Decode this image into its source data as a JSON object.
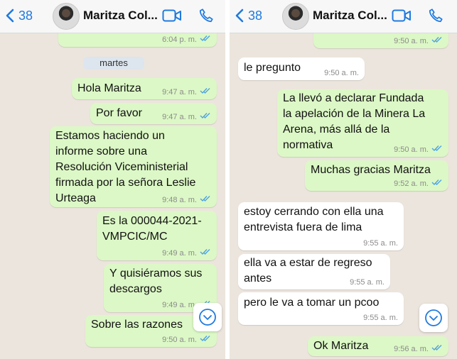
{
  "header": {
    "back_count": "38",
    "contact_name": "Maritza Col..."
  },
  "left_pane": {
    "messages": [
      {
        "text": "",
        "time": "6:04 p. m.",
        "type": "out"
      },
      {
        "text": "Hola Maritza",
        "time": "9:47 a. m.",
        "type": "out"
      },
      {
        "text": "Por favor",
        "time": "9:47 a. m.",
        "type": "out"
      },
      {
        "text": "Estamos haciendo un\ninforme sobre una\nResolución Viceministerial\nfirmada por la señora Leslie\nUrteaga",
        "time": "9:48 a. m.",
        "type": "out"
      },
      {
        "text": "Es la 000044-2021-\nVMPCIC/MC",
        "time": "9:49 a. m.",
        "type": "out"
      },
      {
        "text": "Y quisiéramos sus\ndescargos",
        "time": "9:49 a. m.",
        "type": "out"
      },
      {
        "text": "Sobre las razones",
        "time": "9:50 a. m.",
        "type": "out"
      }
    ],
    "day_separator": "martes"
  },
  "right_pane": {
    "messages": [
      {
        "text": "",
        "time": "9:50 a. m.",
        "type": "out"
      },
      {
        "text": "le pregunto",
        "time": "9:50 a. m.",
        "type": "in"
      },
      {
        "text": "La llevó a declarar Fundada\nla apelación de la Minera La\nArena, más allá de la\nnormativa",
        "time": "9:50 a. m.",
        "type": "out"
      },
      {
        "text": "Muchas gracias Maritza",
        "time": "9:52 a. m.",
        "type": "out"
      },
      {
        "text": "estoy cerrando con ella una\nentrevista fuera de lima",
        "time": "9:55 a. m.",
        "type": "in"
      },
      {
        "text": "ella va a estar de regreso\nantes",
        "time": "9:55 a. m.",
        "type": "in"
      },
      {
        "text": "pero le va a tomar un pcoo",
        "time": "9:55 a. m.",
        "type": "in"
      },
      {
        "text": "Ok Maritza",
        "time": "9:56 a. m.",
        "type": "out"
      }
    ]
  },
  "colors": {
    "outgoing_bubble": "#dcf8c6",
    "incoming_bubble": "#ffffff",
    "accent": "#1f7ae0",
    "read_ticks": "#4fa3e0"
  },
  "icons": [
    "chevron-left-icon",
    "video-camera-icon",
    "phone-icon",
    "double-check-icon",
    "chevron-down-circle-icon"
  ]
}
